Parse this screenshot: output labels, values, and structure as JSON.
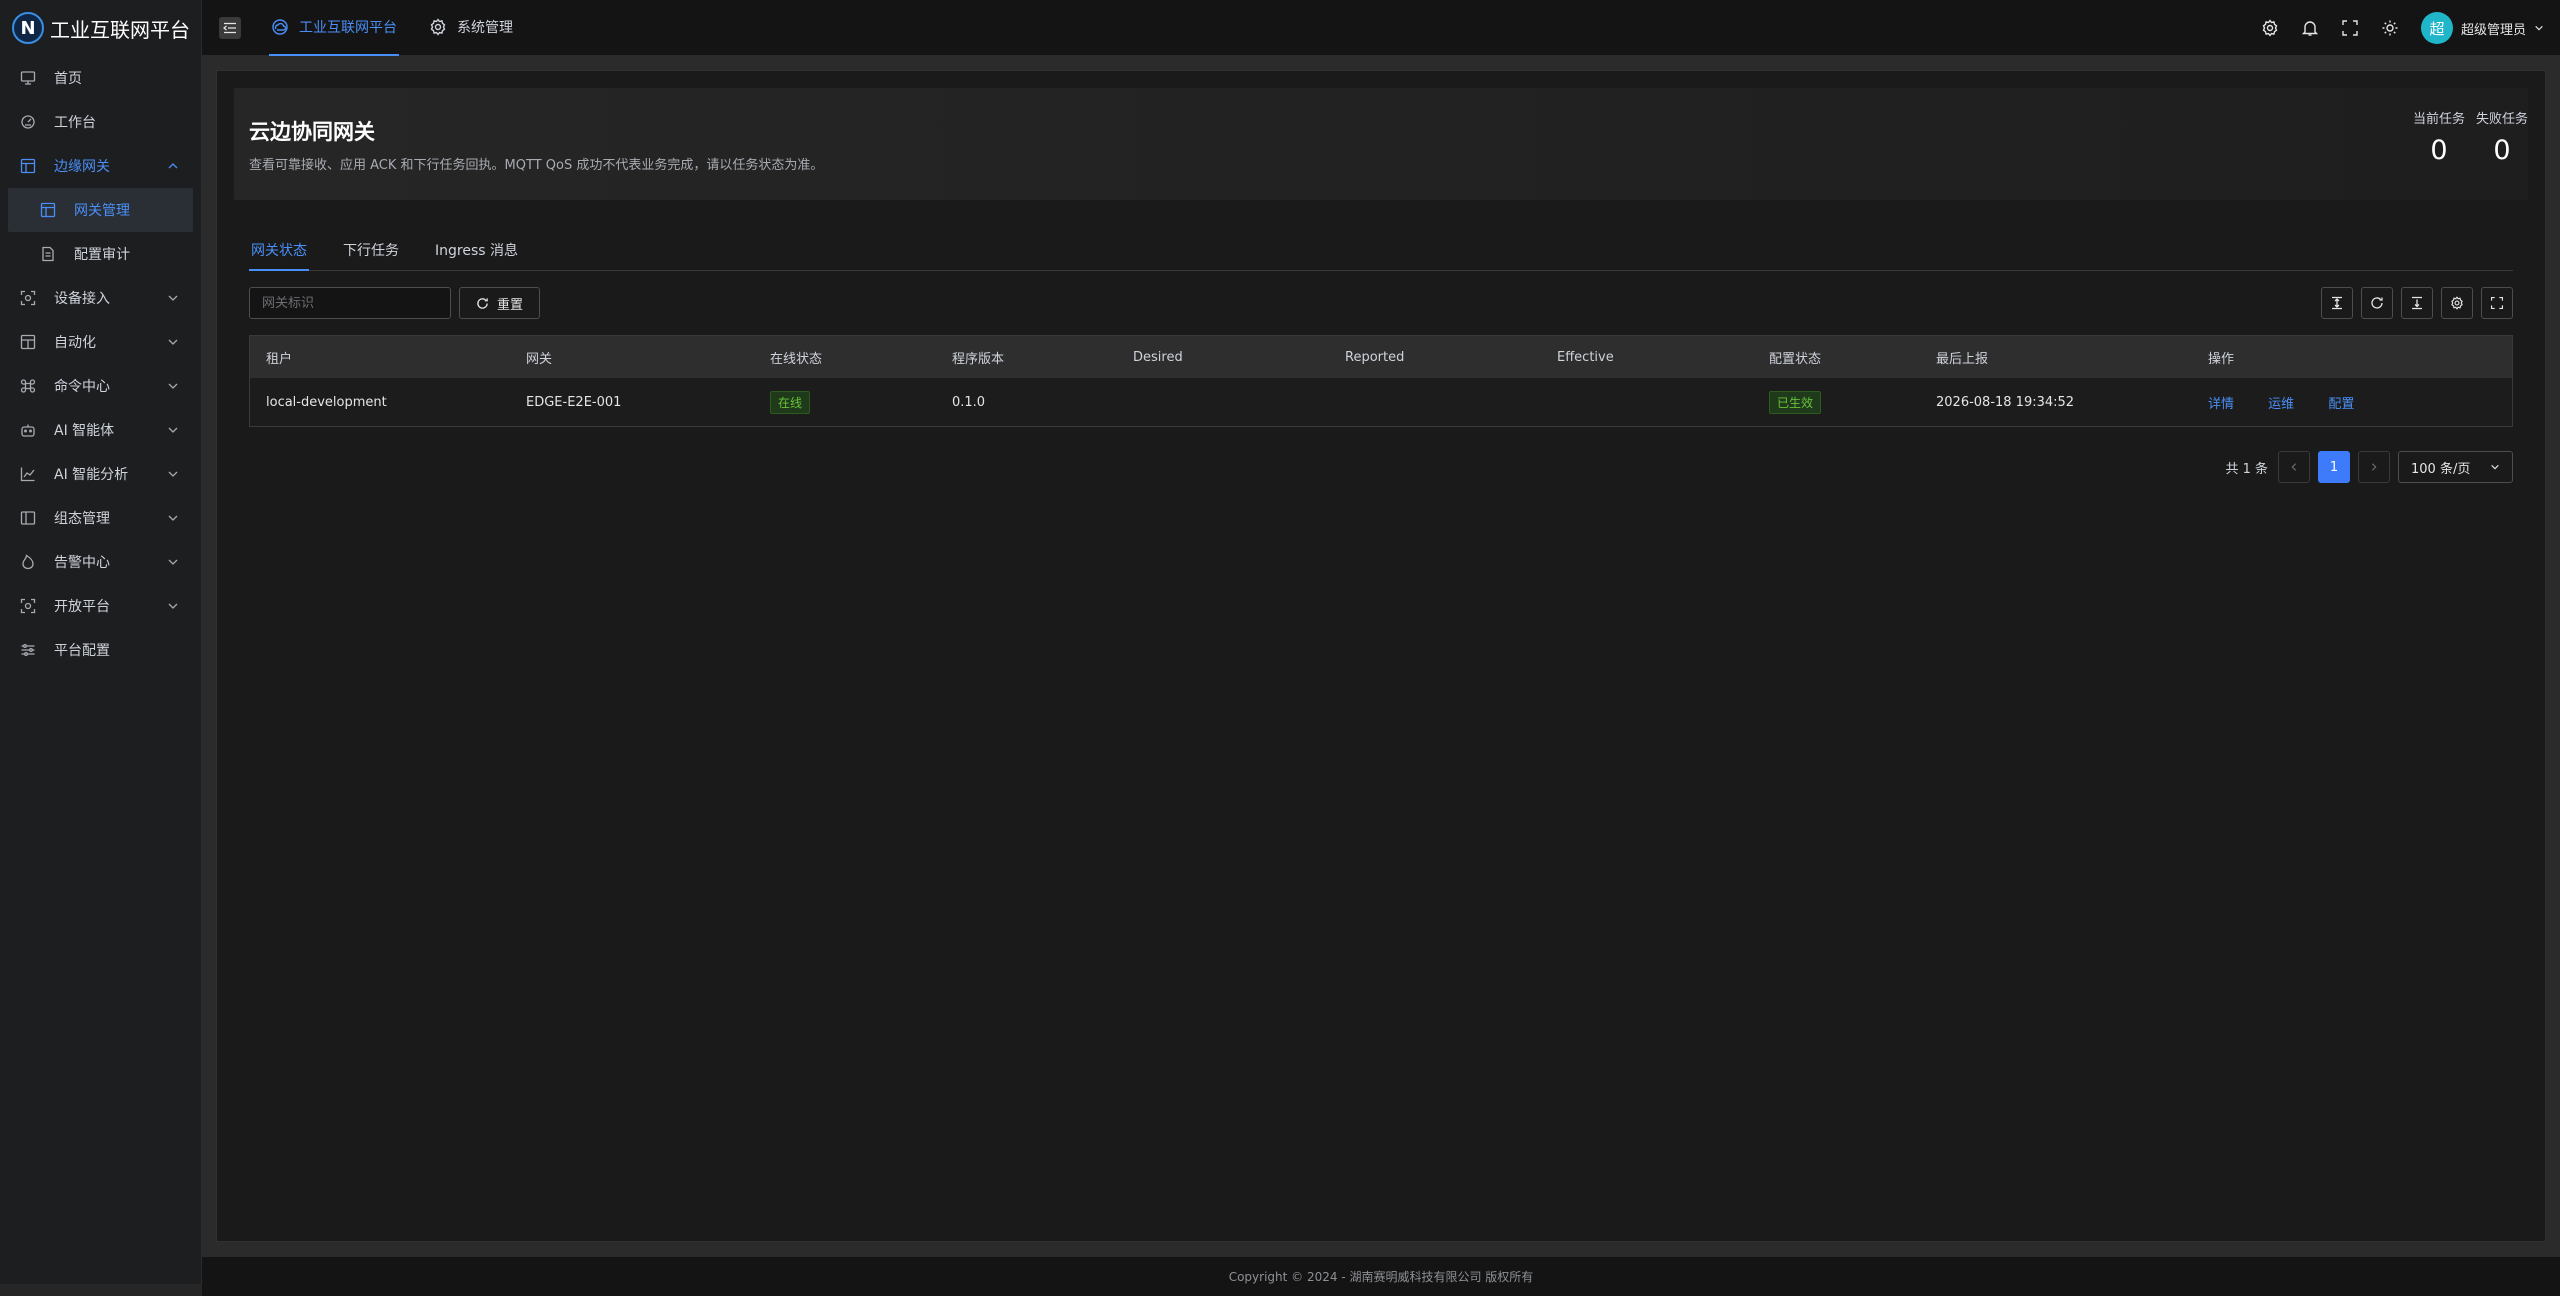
{
  "app": {
    "title": "工业互联网平台"
  },
  "sidebar": {
    "items": [
      {
        "label": "首页",
        "icon": "monitor-icon"
      },
      {
        "label": "工作台",
        "icon": "dashboard-icon"
      },
      {
        "label": "边缘网关",
        "icon": "layout-icon",
        "open": true,
        "children": [
          {
            "label": "网关管理",
            "icon": "layout-icon",
            "active": true
          },
          {
            "label": "配置审计",
            "icon": "document-icon"
          }
        ]
      },
      {
        "label": "设备接入",
        "icon": "scan-icon"
      },
      {
        "label": "自动化",
        "icon": "layout-icon"
      },
      {
        "label": "命令中心",
        "icon": "command-icon"
      },
      {
        "label": "AI 智能体",
        "icon": "robot-icon"
      },
      {
        "label": "AI 智能分析",
        "icon": "chart-line-icon"
      },
      {
        "label": "组态管理",
        "icon": "panel-icon"
      },
      {
        "label": "告警中心",
        "icon": "fire-icon"
      },
      {
        "label": "开放平台",
        "icon": "scan-icon"
      },
      {
        "label": "平台配置",
        "icon": "sliders-icon"
      }
    ]
  },
  "topbar": {
    "tabs": [
      {
        "label": "工业互联网平台",
        "active": true,
        "icon": "cloud-icon"
      },
      {
        "label": "系统管理",
        "active": false,
        "icon": "gear-icon"
      }
    ],
    "user": {
      "avatar_text": "超",
      "name": "超级管理员"
    }
  },
  "hero": {
    "title": "云边协同网关",
    "description": "查看可靠接收、应用 ACK 和下行任务回执。MQTT QoS 成功不代表业务完成，请以任务状态为准。",
    "stats": [
      {
        "label": "当前任务",
        "value": "0"
      },
      {
        "label": "失败任务",
        "value": "0"
      }
    ]
  },
  "tabs": [
    {
      "label": "网关状态",
      "active": true
    },
    {
      "label": "下行任务",
      "active": false
    },
    {
      "label": "Ingress 消息",
      "active": false
    }
  ],
  "toolbar": {
    "search_placeholder": "网关标识",
    "reset_label": "重置"
  },
  "table": {
    "columns": [
      "租户",
      "网关",
      "在线状态",
      "程序版本",
      "Desired",
      "Reported",
      "Effective",
      "配置状态",
      "最后上报",
      "操作"
    ],
    "rows": [
      {
        "tenant": "local-development",
        "gateway": "EDGE-E2E-001",
        "online": "在线",
        "version": "0.1.0",
        "desired": "",
        "reported": "",
        "effective": "",
        "config_status": "已生效",
        "last_report": "2026-08-18 19:34:52",
        "actions": [
          "详情",
          "运维",
          "配置"
        ]
      }
    ]
  },
  "pagination": {
    "total_text": "共 1 条",
    "current_page": "1",
    "page_size": "100 条/页"
  },
  "footer": {
    "copyright": "Copyright © 2024 - 湖南赛明威科技有限公司 版权所有"
  },
  "colors": {
    "accent": "#4a8ff7",
    "success": "#67c23a",
    "background": "#141414"
  }
}
